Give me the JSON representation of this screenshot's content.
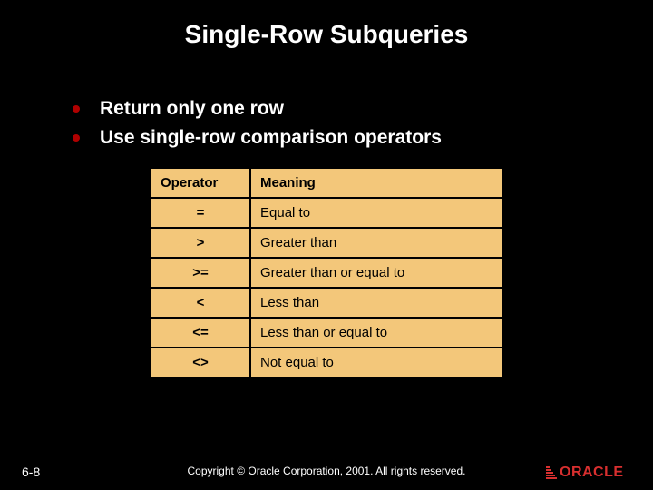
{
  "title": "Single-Row Subqueries",
  "bullets": [
    "Return only one row",
    "Use single-row comparison operators"
  ],
  "table": {
    "header": {
      "op": "Operator",
      "meaning": "Meaning"
    },
    "rows": [
      {
        "op": "=",
        "meaning": "Equal to"
      },
      {
        "op": ">",
        "meaning": "Greater than"
      },
      {
        "op": ">=",
        "meaning": "Greater than or equal to"
      },
      {
        "op": "<",
        "meaning": "Less than"
      },
      {
        "op": "<=",
        "meaning": "Less than or equal to"
      },
      {
        "op": "<>",
        "meaning": "Not equal to"
      }
    ]
  },
  "footer": {
    "page": "6-8",
    "copyright": "Copyright © Oracle Corporation, 2001. All rights reserved.",
    "logo_text": "ORACLE"
  }
}
